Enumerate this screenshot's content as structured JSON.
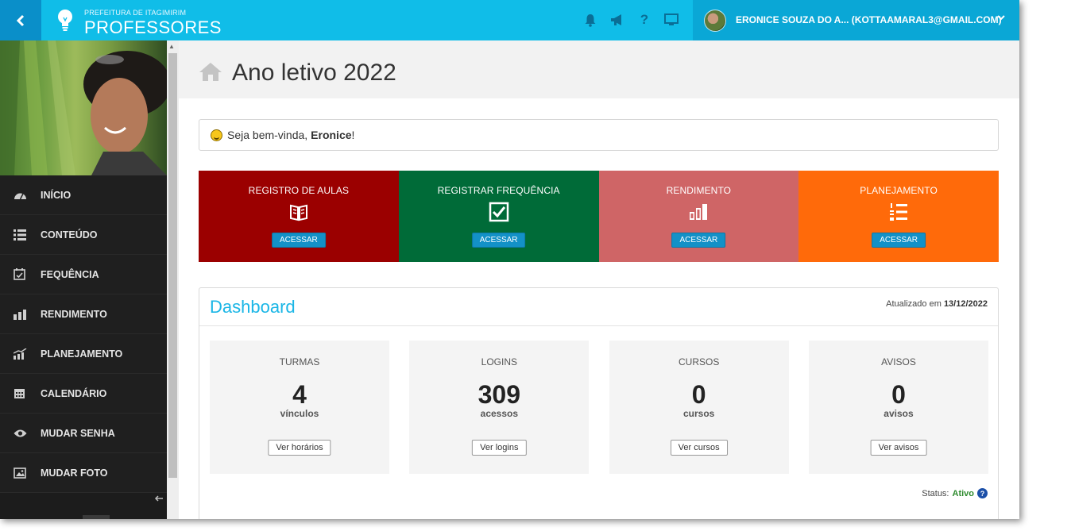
{
  "header": {
    "org": "PREFEITURA DE ITAGIMIRIM",
    "app": "PROFESSORES",
    "user": "ERONICE SOUZA DO A... (KOTTAAMARAL3@GMAIL.COM)",
    "icons": [
      "bell-icon",
      "megaphone-icon",
      "help-icon",
      "monitor-icon"
    ]
  },
  "sidebar": {
    "items": [
      {
        "label": "INÍCIO",
        "icon": "dashboard-icon"
      },
      {
        "label": "CONTEÚDO",
        "icon": "list-icon"
      },
      {
        "label": "FEQUÊNCIA",
        "icon": "calendar-check-icon"
      },
      {
        "label": "RENDIMENTO",
        "icon": "bar-chart-icon"
      },
      {
        "label": "PLANEJAMENTO",
        "icon": "line-chart-icon"
      },
      {
        "label": "CALENDÁRIO",
        "icon": "calendar-icon"
      },
      {
        "label": "MUDAR SENHA",
        "icon": "eye-icon"
      },
      {
        "label": "MUDAR FOTO",
        "icon": "picture-icon"
      }
    ]
  },
  "page": {
    "title": "Ano letivo 2022",
    "welcome_prefix": "Seja bem-vinda,",
    "welcome_name": "Eronice",
    "welcome_suffix": "!"
  },
  "tiles": [
    {
      "title": "REGISTRO DE AULAS",
      "button": "ACESSAR",
      "color": "#9b0000"
    },
    {
      "title": "REGISTRAR FREQUÊNCIA",
      "button": "ACESSAR",
      "color": "#006b38"
    },
    {
      "title": "RENDIMENTO",
      "button": "ACESSAR",
      "color": "#cf6566"
    },
    {
      "title": "PLANEJAMENTO",
      "button": "ACESSAR",
      "color": "#ff6a0a"
    }
  ],
  "dashboard": {
    "title": "Dashboard",
    "updated_label": "Atualizado em",
    "updated_date": "13/12/2022",
    "cards": [
      {
        "label": "TURMAS",
        "value": "4",
        "unit": "vínculos",
        "button": "Ver horários"
      },
      {
        "label": "LOGINS",
        "value": "309",
        "unit": "acessos",
        "button": "Ver logins"
      },
      {
        "label": "CURSOS",
        "value": "0",
        "unit": "cursos",
        "button": "Ver cursos"
      },
      {
        "label": "AVISOS",
        "value": "0",
        "unit": "avisos",
        "button": "Ver avisos"
      }
    ],
    "status_label": "Status:",
    "status_value": "Ativo"
  },
  "colors": {
    "topbar": "#10bde8",
    "accent": "#1ab6e6",
    "sidebar": "#1c1c1c"
  }
}
